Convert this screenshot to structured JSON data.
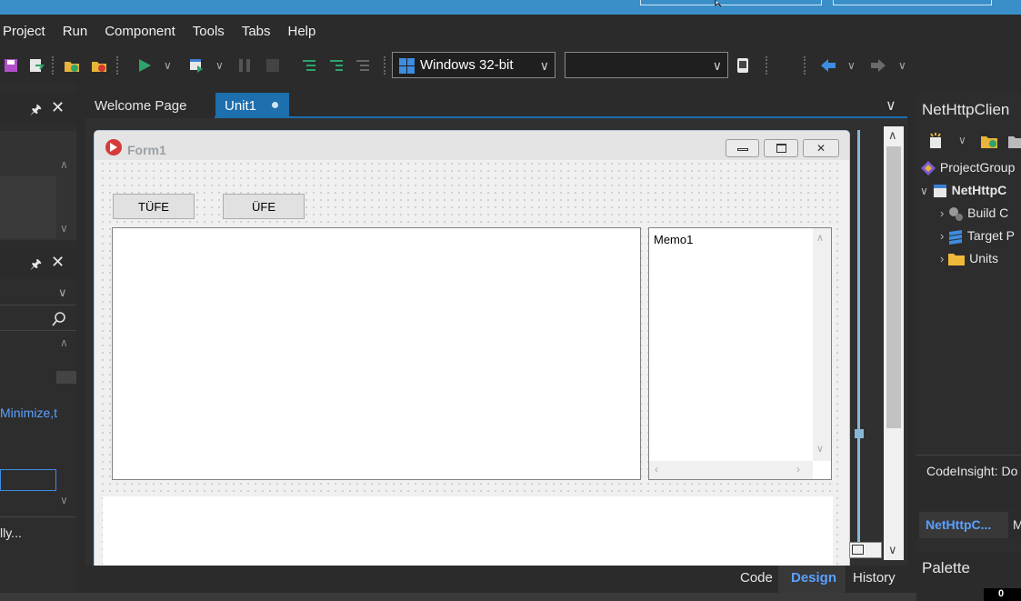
{
  "menu": [
    "Project",
    "Run",
    "Component",
    "Tools",
    "Tabs",
    "Help"
  ],
  "toolbar": {
    "platform": "Windows 32-bit",
    "config": ""
  },
  "left": {
    "text_minimize": "Minimize,t",
    "text_ally": "lly..."
  },
  "tabs": [
    {
      "label": "Welcome Page"
    },
    {
      "label": "Unit1"
    }
  ],
  "form": {
    "title": "Form1",
    "btn1": "TÜFE",
    "btn2": "ÜFE",
    "memo": "Memo1"
  },
  "bottom": {
    "code": "Code",
    "design": "Design",
    "history": "History"
  },
  "right": {
    "title": "NetHttpClien",
    "tree": [
      {
        "label": "ProjectGroup"
      },
      {
        "label": "NetHttpC"
      },
      {
        "label": "Build C"
      },
      {
        "label": "Target P"
      },
      {
        "label": "Units"
      }
    ],
    "codeinsight": "CodeInsight: Do",
    "tab_active": "NetHttpC...",
    "tab_m": "M",
    "palette": "Palette",
    "counter": "0"
  },
  "colors": {
    "accent": "#1d6fae",
    "titlebar": "#3a8fc9",
    "link": "#5aa0ff"
  }
}
